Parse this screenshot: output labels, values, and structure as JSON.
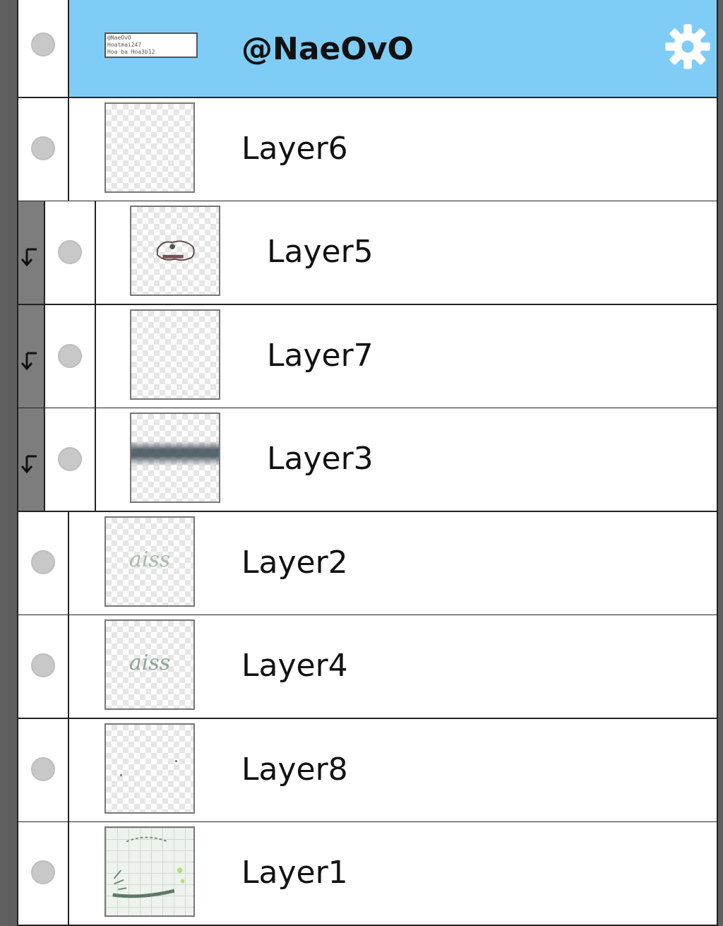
{
  "layers": [
    {
      "id": "naeovo",
      "name": "@NaeOvO",
      "selected": true,
      "clipped": false,
      "thumb_text": [
        "@NaeOvO",
        "Hoatmai247",
        "Hoa ba Hoa3b12"
      ]
    },
    {
      "id": "layer6",
      "name": "Layer6",
      "selected": false,
      "clipped": false
    },
    {
      "id": "layer5",
      "name": "Layer5",
      "selected": false,
      "clipped": true
    },
    {
      "id": "layer7",
      "name": "Layer7",
      "selected": false,
      "clipped": true
    },
    {
      "id": "layer3",
      "name": "Layer3",
      "selected": false,
      "clipped": true
    },
    {
      "id": "layer2",
      "name": "Layer2",
      "selected": false,
      "clipped": false,
      "thumb_text": "aiss"
    },
    {
      "id": "layer4",
      "name": "Layer4",
      "selected": false,
      "clipped": false,
      "thumb_text": "aiss"
    },
    {
      "id": "layer8",
      "name": "Layer8",
      "selected": false,
      "clipped": false
    },
    {
      "id": "layer1",
      "name": "Layer1",
      "selected": false,
      "clipped": false
    }
  ],
  "colors": {
    "selected_row": "#7fcdf6",
    "clip_bar": "#7d7d7d",
    "gear": "#ffffff"
  },
  "icons": {
    "visibility": "visibility-dot-icon",
    "clipping": "clip-arrow-icon",
    "settings": "gear-icon"
  }
}
